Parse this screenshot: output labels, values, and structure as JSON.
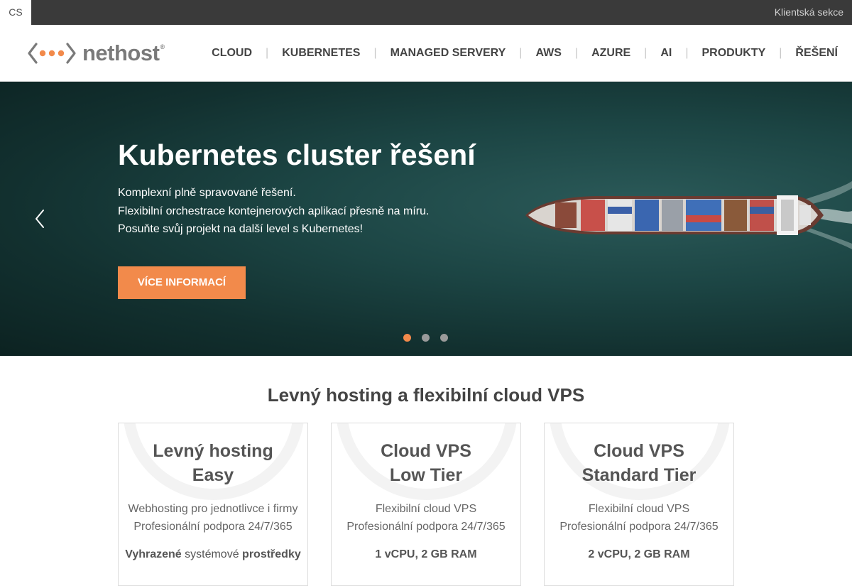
{
  "topbar": {
    "lang": "CS",
    "client_link": "Klientská sekce"
  },
  "logo": {
    "text": "nethost",
    "mark": "®",
    "icon": "nethost-brackets-dots-icon"
  },
  "nav": {
    "items": [
      {
        "label": "CLOUD"
      },
      {
        "label": "KUBERNETES"
      },
      {
        "label": "MANAGED SERVERY"
      },
      {
        "label": "AWS"
      },
      {
        "label": "AZURE"
      },
      {
        "label": "AI"
      },
      {
        "label": "PRODUKTY"
      },
      {
        "label": "ŘEŠENÍ"
      }
    ],
    "separator": "|"
  },
  "hero": {
    "title": "Kubernetes cluster řešení",
    "lines": [
      "Komplexní plně spravované řešení.",
      "Flexibilní orchestrace kontejnerových aplikací přesně na míru.",
      "Posuňte svůj projekt na další level s Kubernetes!"
    ],
    "button": "VÍCE INFORMACÍ",
    "prev_icon": "chevron-left-icon",
    "slides": 3,
    "active_slide": 1,
    "colors": {
      "accent": "#f28a4b",
      "sea": "#1c4544"
    }
  },
  "section": {
    "title": "Levný hosting a flexibilní cloud VPS",
    "cards": [
      {
        "title_line1": "Levný hosting",
        "title_line2": "Easy",
        "desc_line1": "Webhosting pro jednotlivce i firmy",
        "desc_line2": "Profesionální podpora 24/7/365",
        "spec_a": "Vyhrazené",
        "spec_b": " systémové ",
        "spec_c": "prostředky"
      },
      {
        "title_line1": "Cloud VPS",
        "title_line2": "Low Tier",
        "desc_line1": "Flexibilní cloud VPS",
        "desc_line2": "Profesionální podpora 24/7/365",
        "spec_a": "1 vCPU, 2 GB RAM",
        "spec_b": "",
        "spec_c": ""
      },
      {
        "title_line1": "Cloud VPS",
        "title_line2": "Standard Tier",
        "desc_line1": "Flexibilní cloud VPS",
        "desc_line2": "Profesionální podpora 24/7/365",
        "spec_a": "2 vCPU, 2 GB RAM",
        "spec_b": "",
        "spec_c": ""
      }
    ]
  }
}
